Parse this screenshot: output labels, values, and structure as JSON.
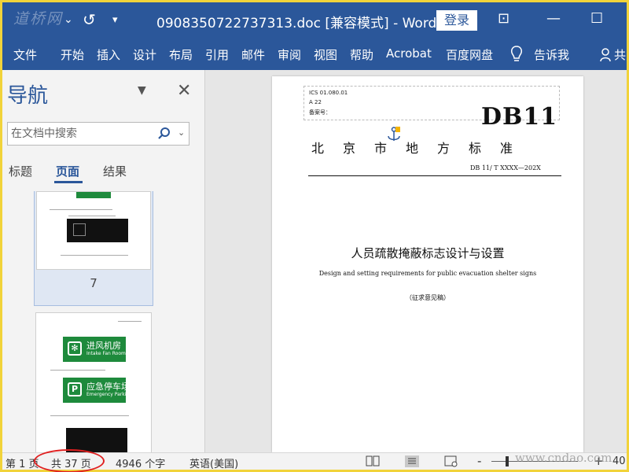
{
  "titlebar": {
    "watermark": "道桥网",
    "doc_title": "0908350722737313.doc [兼容模式] - Word",
    "login_label": "登录"
  },
  "menu": {
    "items": [
      "文件",
      "开始",
      "插入",
      "设计",
      "布局",
      "引用",
      "邮件",
      "审阅",
      "视图",
      "帮助",
      "Acrobat",
      "百度网盘",
      "告诉我"
    ],
    "share_label": "共"
  },
  "nav": {
    "title": "导航",
    "search_placeholder": "在文档中搜索",
    "tabs": [
      "标题",
      "页面",
      "结果"
    ],
    "active_tab": "页面",
    "thumb_page_number": "7",
    "signs": [
      {
        "cn": "进风机房",
        "en": "Intake Fan Room",
        "icon": "fan-icon"
      },
      {
        "cn": "应急停车场",
        "en": "Emergency Parking",
        "icon": "parking-icon"
      }
    ]
  },
  "page": {
    "ics_lines": [
      "ICS 01.080.01",
      "A 22",
      "备案号："
    ],
    "db_mark": "DB11",
    "std_name": "北京市地方标准",
    "std_code": "DB 11/ T XXXX—202X",
    "title_cn": "人员疏散掩蔽标志设计与设置",
    "title_en": "Design and setting requirements for public evacuation shelter signs",
    "note": "（征求意见稿）"
  },
  "status": {
    "page": "第 1 页",
    "total": "共 37 页",
    "words": "4946 个字",
    "language": "英语(美国)",
    "zoom_minus": "-",
    "zoom_plus": "+",
    "zoom": "40",
    "site_mark": "www.cndao.com"
  },
  "colors": {
    "brand": "#2b579a",
    "sign_green": "#1e8a3c",
    "highlight_circle": "#e02020",
    "frame": "#f1d33a"
  }
}
